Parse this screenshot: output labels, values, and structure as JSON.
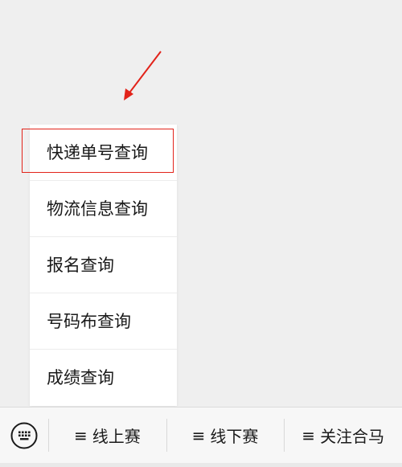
{
  "menu": {
    "items": [
      {
        "label": "快递单号查询"
      },
      {
        "label": "物流信息查询"
      },
      {
        "label": "报名查询"
      },
      {
        "label": "号码布查询"
      },
      {
        "label": "成绩查询"
      }
    ],
    "highlighted_index": 0
  },
  "bottom_bar": {
    "keyboard_icon": "keyboard-icon",
    "tabs": [
      {
        "icon": "≡",
        "label": "线上赛"
      },
      {
        "icon": "≡",
        "label": "线下赛"
      },
      {
        "icon": "≡",
        "label": "关注合马"
      }
    ]
  },
  "annotations": {
    "arrow_color": "#e2231a",
    "highlight_color": "#e2231a"
  }
}
